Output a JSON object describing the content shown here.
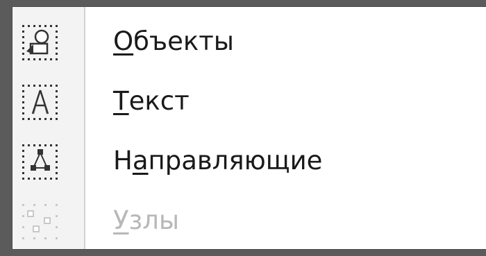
{
  "context_menu": {
    "items": [
      {
        "mnemonic": "О",
        "rest": "бъекты",
        "icon": "snap-objects-icon",
        "disabled": false
      },
      {
        "mnemonic": "Т",
        "rest": "екст",
        "icon": "snap-text-icon",
        "disabled": false
      },
      {
        "before": "Н",
        "mnemonic": "а",
        "rest": "правляющие",
        "icon": "snap-guides-icon",
        "disabled": false
      },
      {
        "mnemonic": "У",
        "rest": "злы",
        "icon": "snap-nodes-icon",
        "disabled": true
      }
    ]
  },
  "colors": {
    "text": "#1a1a1a",
    "disabled_text": "#b8b8b8",
    "menu_background": "#ffffff",
    "gutter_background": "#f3f3f3",
    "outer_background": "#5b5b5b"
  }
}
